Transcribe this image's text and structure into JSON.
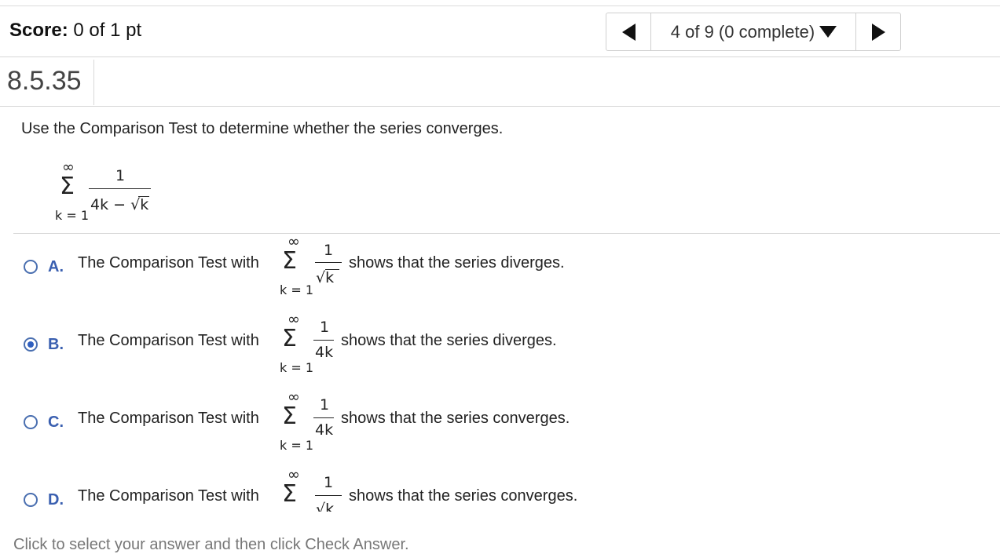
{
  "header": {
    "score_label": "Score:",
    "score_value": "0 of 1 pt",
    "nav_position": "4 of 9 (0 complete)"
  },
  "question": {
    "number": "8.5.35",
    "prompt": "Use the Comparison Test to determine whether the series converges.",
    "series": {
      "upper": "∞",
      "lower": "k = 1",
      "numerator": "1",
      "denominator_prefix": "4k −",
      "radicand": "k"
    }
  },
  "options": [
    {
      "letter": "A.",
      "prefix": "The Comparison Test with",
      "upper": "∞",
      "lower": "k = 1",
      "numerator": "1",
      "denominator": "k",
      "suffix": "shows that the series diverges.",
      "selected": false
    },
    {
      "letter": "B.",
      "prefix": "The Comparison Test with",
      "upper": "∞",
      "lower": "k = 1",
      "numerator": "1",
      "denominator": "4k",
      "suffix": "shows that the series diverges.",
      "selected": true
    },
    {
      "letter": "C.",
      "prefix": "The Comparison Test with",
      "upper": "∞",
      "lower": "k = 1",
      "numerator": "1",
      "denominator": "4k",
      "suffix": "shows that the series converges.",
      "selected": false
    },
    {
      "letter": "D.",
      "prefix": "The Comparison Test with",
      "upper": "∞",
      "lower": "",
      "numerator": "1",
      "denominator": "k",
      "suffix": "shows that the series converges.",
      "selected": false
    }
  ],
  "footer": {
    "instruction": "Click to select your answer and then click Check Answer."
  },
  "colors": {
    "accent": "#3a5fb0",
    "radio_selected": "#2f5fbf"
  }
}
